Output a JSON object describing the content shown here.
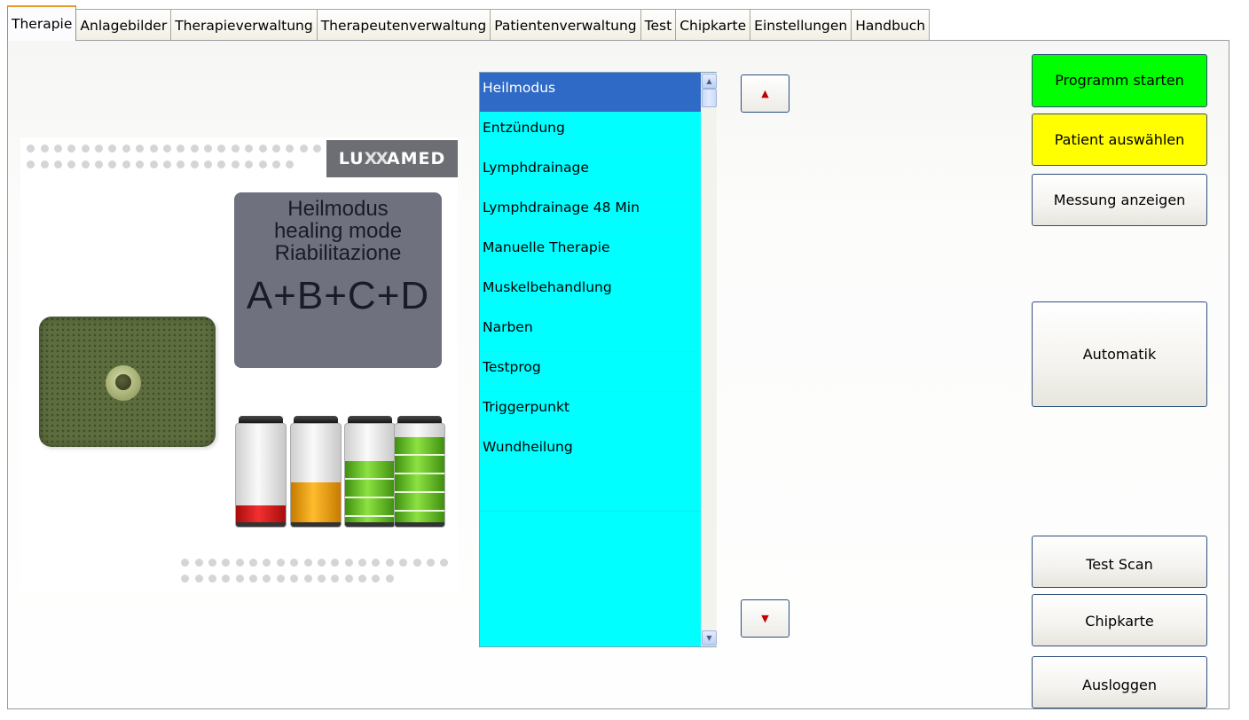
{
  "tabs": [
    {
      "label": "Therapie",
      "active": true
    },
    {
      "label": "Anlagebilder"
    },
    {
      "label": "Therapieverwaltung"
    },
    {
      "label": "Therapeutenverwaltung"
    },
    {
      "label": "Patientenverwaltung"
    },
    {
      "label": "Test"
    },
    {
      "label": "Chipkarte"
    },
    {
      "label": "Einstellungen"
    },
    {
      "label": "Handbuch"
    }
  ],
  "illustration": {
    "logo_left": "LU",
    "logo_mark": "XX",
    "logo_right": "AMED",
    "mode_line1": "Heilmodus",
    "mode_line2": "healing mode",
    "mode_line3": "Riabilitazione",
    "mode_code": "A+B+C+D",
    "battery_levels": [
      0.22,
      0.45,
      0.67,
      0.92
    ]
  },
  "program_list": {
    "items": [
      "Heilmodus",
      "Entzündung",
      "Lymphdrainage",
      "Lymphdrainage 48 Min",
      "Manuelle Therapie",
      "Muskelbehandlung",
      "Narben",
      "Testprog",
      "Triggerpunkt",
      "Wundheilung"
    ],
    "selected": "Heilmodus"
  },
  "buttons": {
    "start": "Programm starten",
    "patient": "Patient auswählen",
    "measurement": "Messung anzeigen",
    "automatic": "Automatik",
    "test_scan": "Test Scan",
    "chipcard": "Chipkarte",
    "logout": "Ausloggen",
    "move_up": "up-arrow-icon",
    "move_down": "down-arrow-icon"
  },
  "colors": {
    "start_bg": "#00ff00",
    "patient_bg": "#ffff00",
    "list_bg": "#00ffff",
    "selection": "#2f6ac6"
  }
}
